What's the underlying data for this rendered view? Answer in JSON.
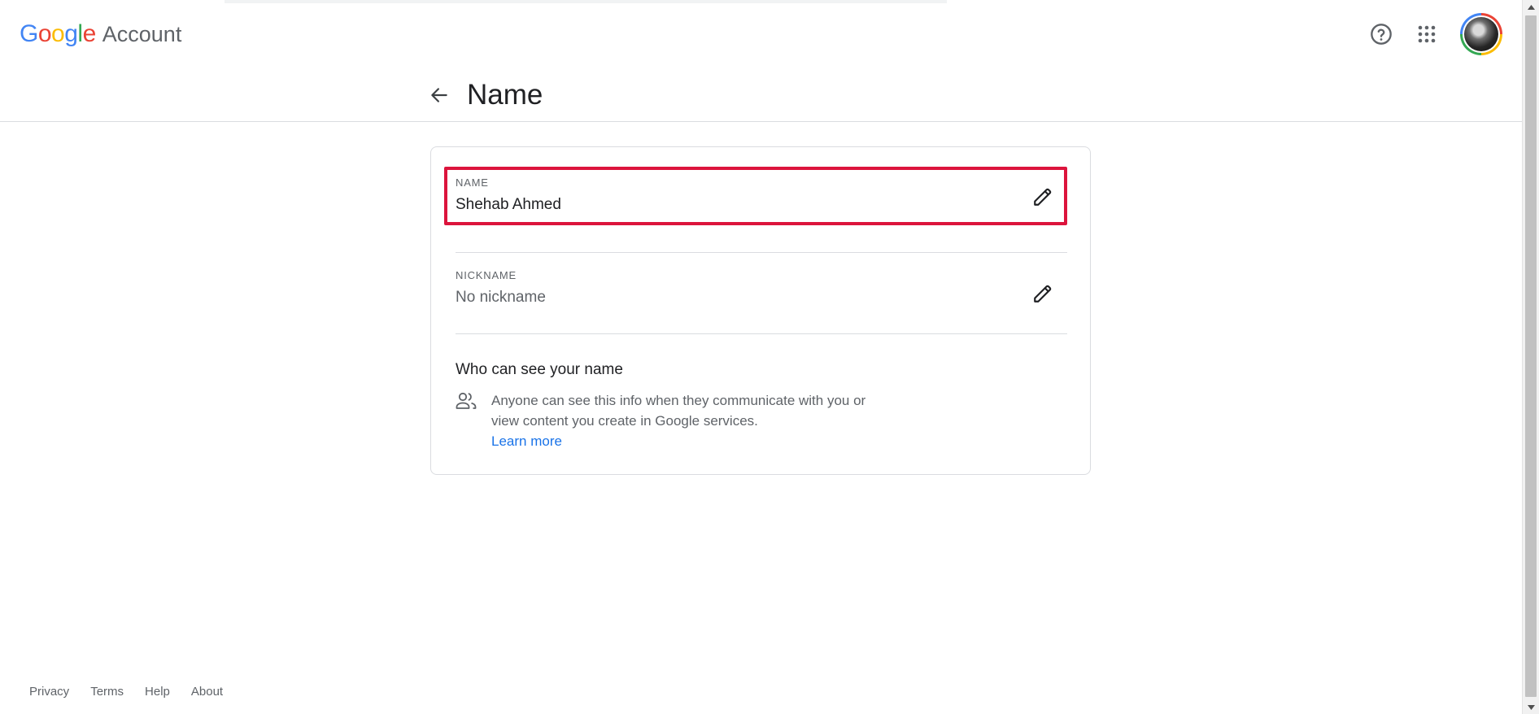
{
  "header": {
    "logo_letters": [
      {
        "char": "G",
        "color": "#4285f4"
      },
      {
        "char": "o",
        "color": "#ea4335"
      },
      {
        "char": "o",
        "color": "#fbbc05"
      },
      {
        "char": "g",
        "color": "#4285f4"
      },
      {
        "char": "l",
        "color": "#34a853"
      },
      {
        "char": "e",
        "color": "#ea4335"
      }
    ],
    "product": "Account",
    "help_icon": "help-circle-icon",
    "apps_icon": "apps-grid-icon",
    "avatar_icon": "account-avatar"
  },
  "subheader": {
    "back_icon": "arrow-back-icon",
    "title": "Name"
  },
  "card": {
    "name_row": {
      "label": "NAME",
      "value": "Shehab Ahmed",
      "edit_icon": "pencil-icon",
      "highlight_color": "#dc143c"
    },
    "nickname_row": {
      "label": "NICKNAME",
      "value": "No nickname",
      "edit_icon": "pencil-icon"
    },
    "visibility": {
      "title": "Who can see your name",
      "icon": "people-icon",
      "text": "Anyone can see this info when they communicate with you or view content you create in Google services.",
      "link": "Learn more",
      "link_color": "#1a73e8"
    }
  },
  "footer": {
    "links": [
      "Privacy",
      "Terms",
      "Help",
      "About"
    ]
  }
}
